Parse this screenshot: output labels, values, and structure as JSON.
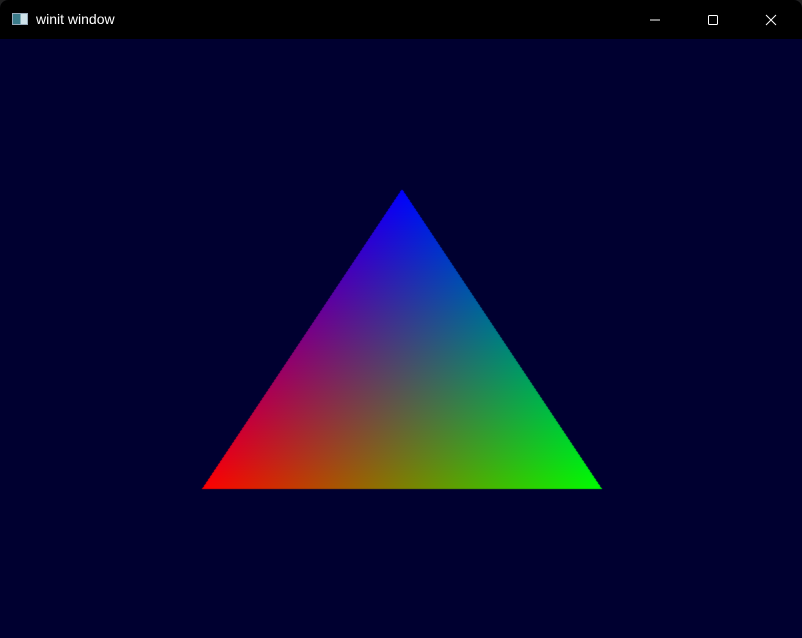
{
  "window": {
    "title": "winit window",
    "background": "#000030"
  },
  "triangle": {
    "vertex_colors": [
      "#0000ff",
      "#ff0000",
      "#00ff00"
    ]
  }
}
